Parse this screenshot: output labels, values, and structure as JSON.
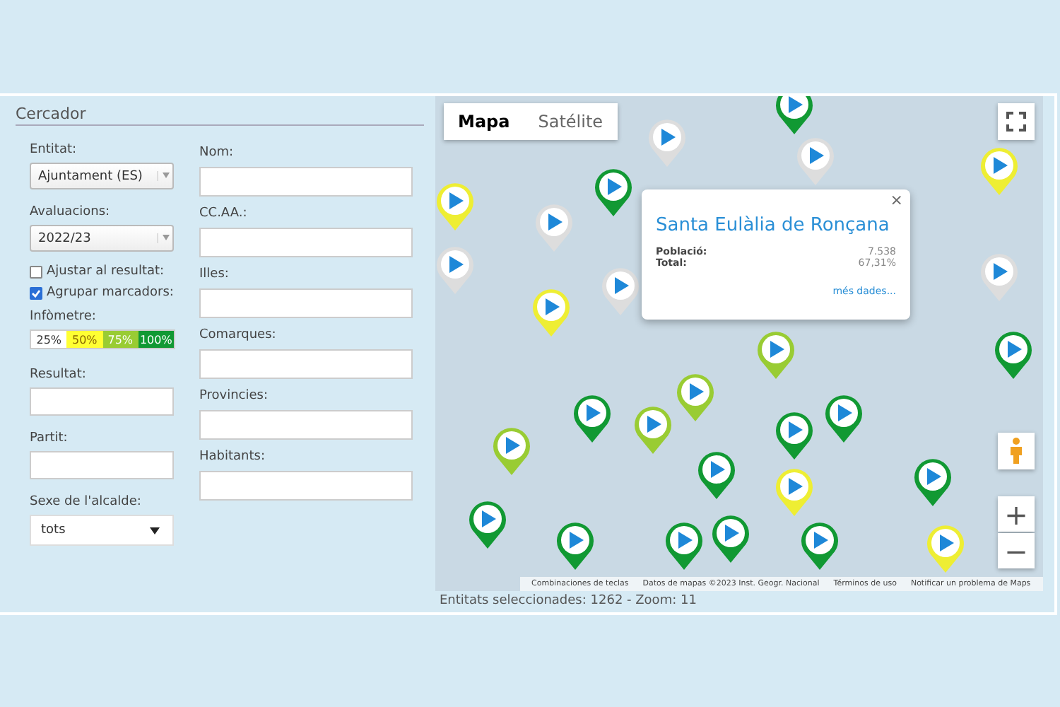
{
  "search_panel": {
    "title": "Cercador",
    "left_fields": [
      {
        "kind": "select",
        "label": "Entitat:",
        "value": "Ajuntament (ES)"
      },
      {
        "kind": "select",
        "label": "Avaluacions:",
        "value": "2022/23"
      },
      {
        "kind": "checkbox",
        "label": "Ajustar al resultat:",
        "checked": false
      },
      {
        "kind": "checkbox",
        "label": "Agrupar marcadors:",
        "checked": true
      },
      {
        "kind": "meter",
        "label": "Infòmetre:",
        "segments": [
          {
            "label": "25%",
            "color": "#ffffff"
          },
          {
            "label": "50%",
            "color": "#ffff33"
          },
          {
            "label": "75%",
            "color": "#99cc33"
          },
          {
            "label": "100%",
            "color": "#119933"
          }
        ]
      },
      {
        "kind": "text",
        "label": "Resultat:"
      },
      {
        "kind": "text",
        "label": "Partit:"
      },
      {
        "kind": "dropdown",
        "label": "Sexe de l'alcalde:",
        "value": "tots"
      }
    ],
    "right_fields": [
      {
        "kind": "text",
        "label": "Nom:"
      },
      {
        "kind": "text",
        "label": "CC.AA.:"
      },
      {
        "kind": "text",
        "label": "Illes:"
      },
      {
        "kind": "text",
        "label": "Comarques:"
      },
      {
        "kind": "text",
        "label": "Provincies:"
      },
      {
        "kind": "text",
        "label": "Habitants:"
      }
    ]
  },
  "map": {
    "map_types": [
      {
        "label": "Mapa",
        "selected": true
      },
      {
        "label": "Satélite",
        "selected": false
      }
    ],
    "popup": {
      "title": "Santa Eulàlia de Ronçana",
      "close": "×",
      "rows": [
        {
          "label": "Població:",
          "value": "7.538"
        },
        {
          "label": "Total:",
          "value": "67,31%"
        }
      ],
      "link": "més dades..."
    },
    "zoom_in": "+",
    "zoom_out": "−",
    "attribution": [
      "Combinaciones de teclas",
      "Datos de mapas ©2023 Inst. Geogr. Nacional",
      "Términos de uso",
      "Notificar un problema de Maps"
    ]
  },
  "status_bar": "Entitats seleccionades: 1262 - Zoom: 11"
}
